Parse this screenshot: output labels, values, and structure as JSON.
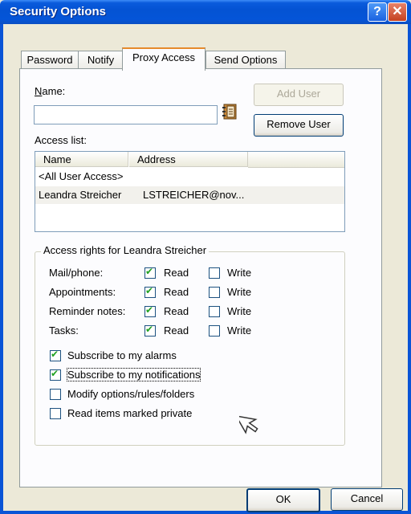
{
  "window": {
    "title": "Security Options"
  },
  "titlebar": {
    "help_glyph": "?",
    "close_glyph": "✕"
  },
  "tabs": [
    {
      "label": "Password",
      "active": false
    },
    {
      "label": "Notify",
      "active": false
    },
    {
      "label": "Proxy Access",
      "active": true
    },
    {
      "label": "Send Options",
      "active": false
    }
  ],
  "name_section": {
    "label": "Name:",
    "value": "",
    "address_book_icon": "address-book-icon"
  },
  "buttons": {
    "add_user": "Add User",
    "remove_user": "Remove User",
    "ok": "OK",
    "cancel": "Cancel"
  },
  "access_list": {
    "label": "Access list:",
    "columns": [
      "Name",
      "Address"
    ],
    "rows": [
      {
        "name": "<All User Access>",
        "address": ""
      },
      {
        "name": "Leandra Streicher",
        "address": "LSTREICHER@nov..."
      }
    ]
  },
  "access_rights": {
    "title": "Access rights for Leandra Streicher",
    "rights": [
      {
        "label": "Mail/phone:",
        "read_label": "Read",
        "read": true,
        "write_label": "Write",
        "write": false
      },
      {
        "label": "Appointments:",
        "read_label": "Read",
        "read": true,
        "write_label": "Write",
        "write": false
      },
      {
        "label": "Reminder notes:",
        "read_label": "Read",
        "read": true,
        "write_label": "Write",
        "write": false
      },
      {
        "label": "Tasks:",
        "read_label": "Read",
        "read": true,
        "write_label": "Write",
        "write": false
      }
    ],
    "options": [
      {
        "label": "Subscribe to my alarms",
        "checked": true
      },
      {
        "label": "Subscribe to my notifications",
        "checked": true
      },
      {
        "label": "Modify options/rules/folders",
        "checked": false
      },
      {
        "label": "Read items marked private",
        "checked": false
      }
    ]
  },
  "colors": {
    "titlebar": "#0453d3",
    "dialog_bg": "#ece9d8",
    "tab_accent": "#e68b2c"
  }
}
